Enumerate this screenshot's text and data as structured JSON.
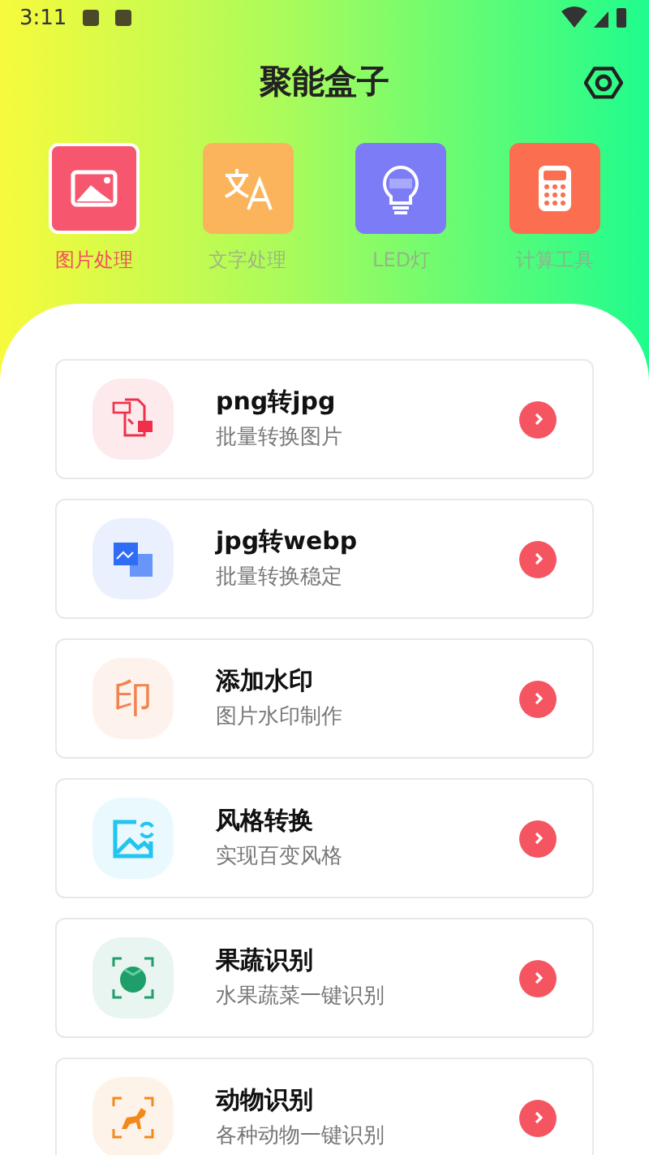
{
  "status_bar": {
    "time": "3:11"
  },
  "header": {
    "title": "聚能盒子"
  },
  "categories": [
    {
      "label": "图片处理",
      "kind": "picture",
      "color": "#f6566e",
      "selected": true
    },
    {
      "label": "文字处理",
      "kind": "translate",
      "color": "#fbb45c",
      "selected": false
    },
    {
      "label": "LED灯",
      "kind": "bulb",
      "color": "#7b7cf6",
      "selected": false
    },
    {
      "label": "计算工具",
      "kind": "calculator",
      "color": "#fb6f50",
      "selected": false
    }
  ],
  "tools": [
    {
      "title": "png转jpg",
      "subtitle": "批量转换图片",
      "kind": "convert",
      "color": "#f0304a"
    },
    {
      "title": "jpg转webp",
      "subtitle": "批量转换稳定",
      "kind": "images",
      "color": "#2f6df6"
    },
    {
      "title": "添加水印",
      "subtitle": "图片水印制作",
      "kind": "stamp",
      "color": "#f2834f",
      "icon_text": "印"
    },
    {
      "title": "风格转换",
      "subtitle": "实现百变风格",
      "kind": "refresh",
      "color": "#23c4ef"
    },
    {
      "title": "果蔬识别",
      "subtitle": "水果蔬菜一键识别",
      "kind": "tomato",
      "color": "#1f9e6a"
    },
    {
      "title": "动物识别",
      "subtitle": "各种动物一键识别",
      "kind": "dog",
      "color": "#f3891c"
    }
  ]
}
